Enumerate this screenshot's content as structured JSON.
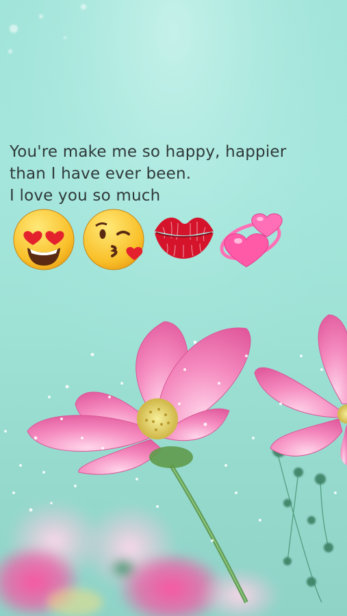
{
  "message": {
    "lines": [
      "You're make me so happy, happier",
      "than I have ever been.",
      "I love you so much"
    ]
  },
  "emojis": [
    {
      "name": "smiling-face-with-heart-eyes-icon",
      "label": "😍"
    },
    {
      "name": "face-blowing-a-kiss-icon",
      "label": "😘"
    },
    {
      "name": "kiss-mark-icon",
      "label": "💋"
    },
    {
      "name": "revolving-hearts-icon",
      "label": "💞"
    }
  ],
  "background": {
    "description_color_top": "#9fe3d8",
    "flower_color": "#f078b0",
    "flower_center_color": "#e8d060"
  }
}
